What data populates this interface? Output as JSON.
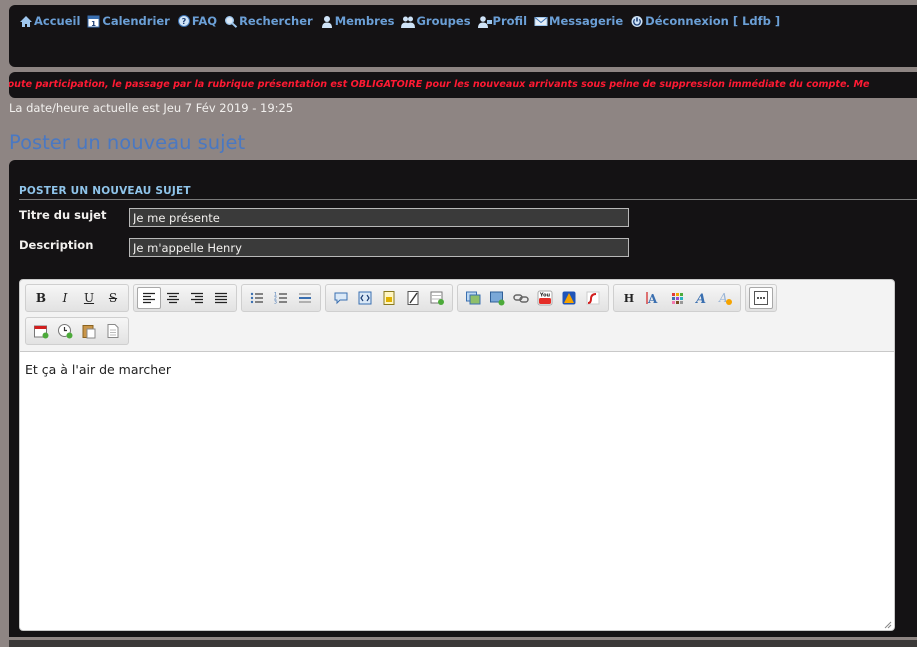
{
  "nav": {
    "items": [
      {
        "label": "Accueil",
        "icon": "home-icon"
      },
      {
        "label": "Calendrier",
        "icon": "calendar-icon"
      },
      {
        "label": "FAQ",
        "icon": "faq-icon"
      },
      {
        "label": "Rechercher",
        "icon": "search-icon"
      },
      {
        "label": "Membres",
        "icon": "member-icon"
      },
      {
        "label": "Groupes",
        "icon": "groups-icon"
      },
      {
        "label": "Profil",
        "icon": "profile-icon"
      },
      {
        "label": "Messagerie",
        "icon": "mail-icon"
      },
      {
        "label": "Déconnexion [ Ldfb ]",
        "icon": "power-icon"
      }
    ]
  },
  "marquee": {
    "text": "toute participation, le passage par la rubrique présentation est OBLIGATOIRE pour les nouveaux arrivants sous peine de suppression immédiate du compte. Me"
  },
  "datetime": "La date/heure actuelle est Jeu 7 Fév 2019 - 19:25",
  "page_title": "Poster un nouveau sujet",
  "form": {
    "section_title": "POSTER UN NOUVEAU SUJET",
    "title_label": "Titre du sujet",
    "title_value": "Je me présente",
    "desc_label": "Description",
    "desc_value": "Je m'appelle Henry"
  },
  "editor": {
    "content": "Et ça à l'air de marcher"
  },
  "colors": {
    "page_bg": "#8e8583",
    "panel_bg": "#141214",
    "nav_link": "#6b9fd6",
    "marquee_text": "#ff1a33",
    "page_title": "#4a78c2",
    "section_title": "#8fc4ea"
  }
}
